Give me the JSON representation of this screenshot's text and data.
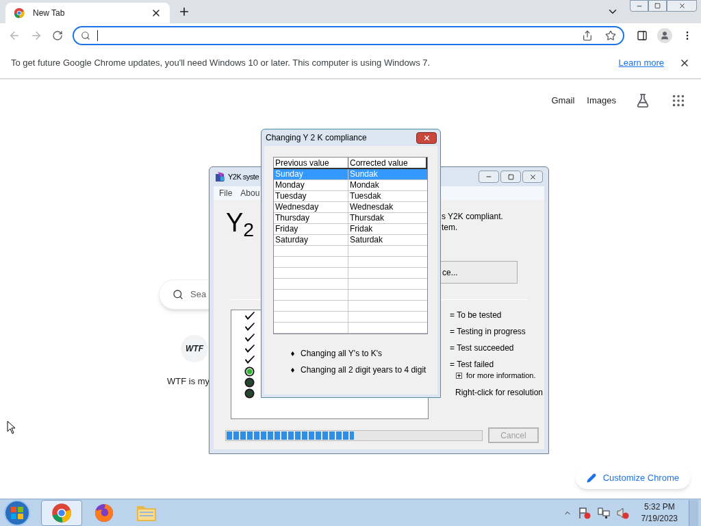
{
  "browser": {
    "tab": {
      "title": "New Tab",
      "selected": true
    },
    "infobar": {
      "message": "To get future Google Chrome updates, you'll need Windows 10 or later. This computer is using Windows 7.",
      "link": "Learn more"
    },
    "page": {
      "top_links": [
        "Gmail",
        "Images"
      ],
      "search": {
        "placeholder": "Sea"
      },
      "shortcut": {
        "icon_text": "WTF",
        "label": "WTF is my"
      },
      "customize_button": "Customize Chrome"
    }
  },
  "y2k_window": {
    "title": "Y2K syste",
    "menu": [
      "File",
      "Abou"
    ],
    "logo": "Y$_{2}$",
    "status_lines": [
      "s Y2K compliant.",
      "tem."
    ],
    "button": "ce...",
    "tests": [
      {
        "kind": "check"
      },
      {
        "kind": "check"
      },
      {
        "kind": "check"
      },
      {
        "kind": "check"
      },
      {
        "kind": "check"
      },
      {
        "kind": "light_on"
      },
      {
        "kind": "light_off"
      },
      {
        "kind": "light_off"
      }
    ],
    "legend": [
      "= To be tested",
      "= Testing in progress",
      "= Test succeeded",
      "= Test failed"
    ],
    "legend_hint": "for more information.",
    "right_click_hint": "Right-click for resolution",
    "progress": {
      "level": 0.5
    },
    "cancel": {
      "label": "Cancel",
      "disabled": true
    }
  },
  "dialog": {
    "title": "Changing Y 2 K compliance",
    "columns": [
      "Previous value",
      "Corrected value"
    ],
    "rows": [
      {
        "previous": "Sunday",
        "corrected": "Sundak",
        "selected": true
      },
      {
        "previous": "Monday",
        "corrected": "Mondak",
        "selected": false
      },
      {
        "previous": "Tuesday",
        "corrected": "Tuesdak",
        "selected": false
      },
      {
        "previous": "Wednesday",
        "corrected": "Wednesdak",
        "selected": false
      },
      {
        "previous": "Thursday",
        "corrected": "Thursdak",
        "selected": false
      },
      {
        "previous": "Friday",
        "corrected": "Fridak",
        "selected": false
      },
      {
        "previous": "Saturday",
        "corrected": "Saturdak",
        "selected": false
      }
    ],
    "notes": [
      "Changing all Y's to K's",
      "Changing all 2 digit years to 4 digit"
    ]
  },
  "taskbar": {
    "apps": [
      {
        "kind": "chrome",
        "selected": true
      },
      {
        "kind": "firefox",
        "selected": false
      },
      {
        "kind": "explorer",
        "selected": false
      }
    ],
    "time": "5:32 PM",
    "date": "7/19/2023"
  }
}
